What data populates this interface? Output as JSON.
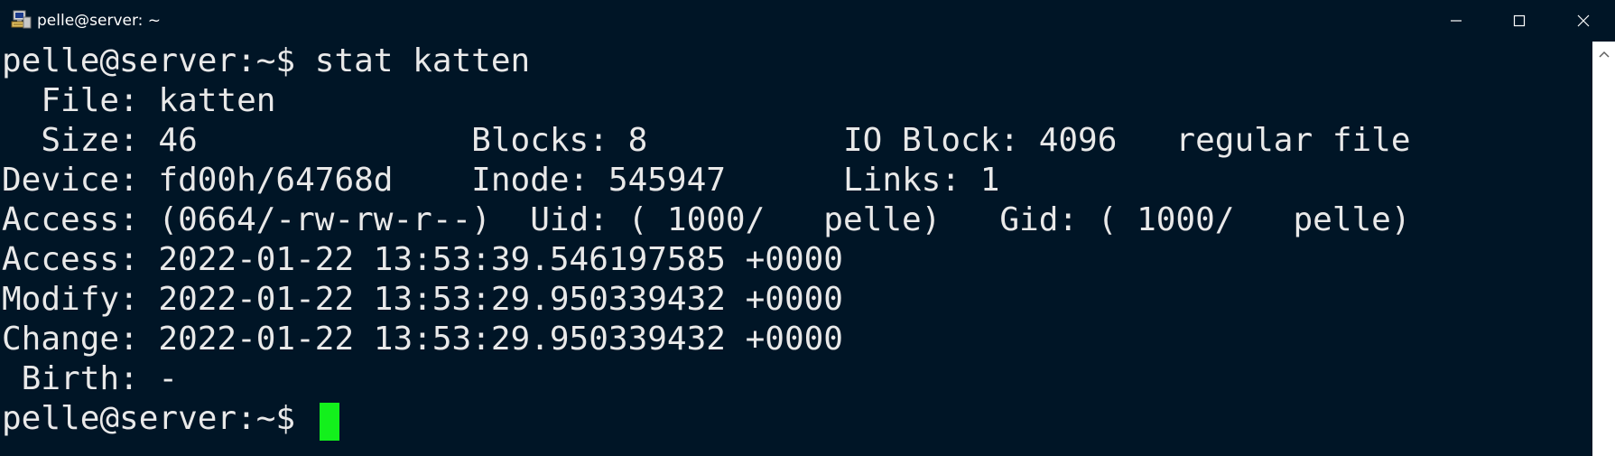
{
  "window": {
    "title": "pelle@server: ~",
    "app_icon": "terminal-computer-icon"
  },
  "controls": {
    "minimize_icon": "minimize-icon",
    "maximize_icon": "maximize-icon",
    "close_icon": "close-icon"
  },
  "terminal": {
    "lines": [
      "pelle@server:~$ stat katten",
      "  File: katten",
      "  Size: 46              Blocks: 8          IO Block: 4096   regular file",
      "Device: fd00h/64768d    Inode: 545947      Links: 1",
      "Access: (0664/-rw-rw-r--)  Uid: ( 1000/   pelle)   Gid: ( 1000/   pelle)",
      "Access: 2022-01-22 13:53:39.546197585 +0000",
      "Modify: 2022-01-22 13:53:29.950339432 +0000",
      "Change: 2022-01-22 13:53:29.950339432 +0000",
      " Birth: -",
      "pelle@server:~$ "
    ]
  },
  "colors": {
    "background": "#001526",
    "text": "#e9e9e9",
    "cursor": "#13f01c"
  }
}
